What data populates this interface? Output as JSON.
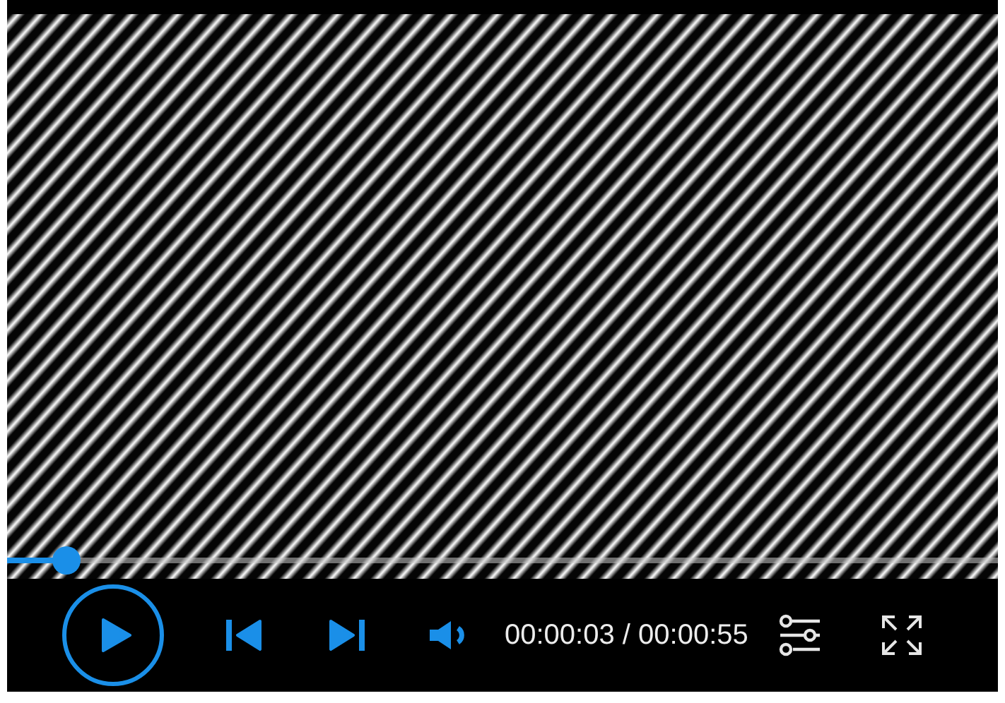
{
  "progress": {
    "level": 0.06
  },
  "controls": {
    "playing": false,
    "muted": false,
    "time": "00:00:03 / 00:00:55"
  }
}
